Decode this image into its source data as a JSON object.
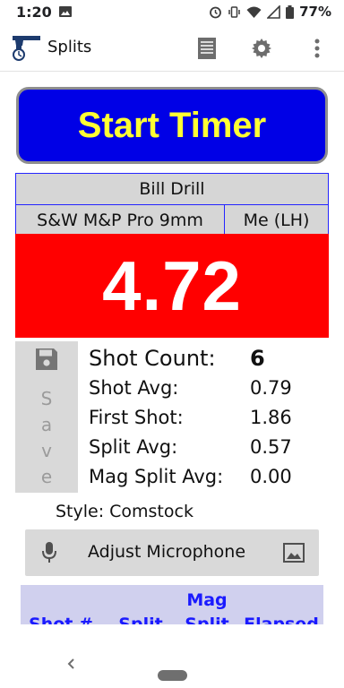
{
  "status_bar": {
    "time": "1:20",
    "battery": "77%",
    "icons": [
      "photo-icon",
      "alarm-icon",
      "vibrate-icon",
      "wifi-icon",
      "signal-icon",
      "battery-icon"
    ]
  },
  "app_bar": {
    "title": "Splits",
    "icons": [
      "app-logo-icon",
      "list-icon",
      "gear-icon",
      "overflow-icon"
    ]
  },
  "start_button": {
    "label": "Start Timer"
  },
  "drill": {
    "name": "Bill Drill",
    "gun": "S&W M&P Pro 9mm",
    "shooter": "Me (LH)"
  },
  "timer": {
    "value": "4.72"
  },
  "save_button": {
    "letters": [
      "S",
      "a",
      "v",
      "e"
    ]
  },
  "stats": [
    {
      "label": "Shot Count:",
      "value": "6"
    },
    {
      "label": "Shot Avg:",
      "value": "0.79"
    },
    {
      "label": "First Shot:",
      "value": "1.86"
    },
    {
      "label": "Split Avg:",
      "value": "0.57"
    },
    {
      "label": "Mag Split Avg:",
      "value": "0.00"
    }
  ],
  "style": {
    "label": "Style:",
    "value": "Comstock"
  },
  "microphone": {
    "label": "Adjust Microphone"
  },
  "shots_table": {
    "columns": [
      {
        "line1": "",
        "line2": "Shot #"
      },
      {
        "line1": "",
        "line2": "Split"
      },
      {
        "line1": "Mag",
        "line2": "Split"
      },
      {
        "line1": "",
        "line2": "Elapsed"
      }
    ]
  },
  "colors": {
    "start_button_bg": "#0000e6",
    "start_button_text": "#ffff33",
    "timer_bg": "#ff0000",
    "table_border": "#2424ff",
    "header_text": "#1a1aff"
  }
}
